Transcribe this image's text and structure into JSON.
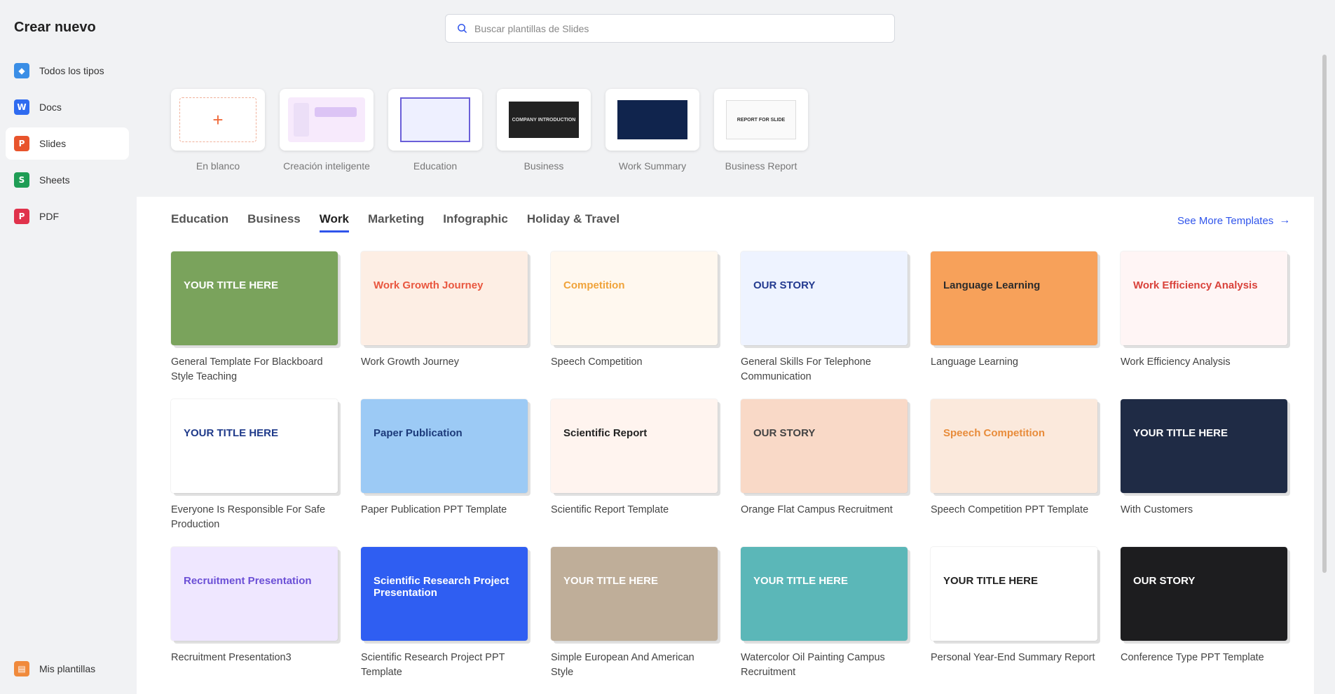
{
  "sidebar": {
    "title": "Crear nuevo",
    "items": [
      {
        "label": "Todos los tipos",
        "icon": "layers-icon",
        "color": "#3a8ee6"
      },
      {
        "label": "Docs",
        "icon": "docs-icon",
        "color": "#2f6bf0",
        "glyph": "W"
      },
      {
        "label": "Slides",
        "icon": "slides-icon",
        "color": "#e8542c",
        "glyph": "P"
      },
      {
        "label": "Sheets",
        "icon": "sheets-icon",
        "color": "#1f9d55",
        "glyph": "S"
      },
      {
        "label": "PDF",
        "icon": "pdf-icon",
        "color": "#e0324b",
        "glyph": "P"
      }
    ],
    "active_index": 2,
    "my_templates": "Mis plantillas"
  },
  "search": {
    "placeholder": "Buscar plantillas de Slides"
  },
  "quick": [
    {
      "label": "En blanco"
    },
    {
      "label": "Creación inteligente"
    },
    {
      "label": "Education"
    },
    {
      "label": "Business",
      "thumb_text": "COMPANY INTRODUCTION"
    },
    {
      "label": "Work Summary"
    },
    {
      "label": "Business Report",
      "thumb_text": "REPORT FOR SLIDE"
    }
  ],
  "tabs": [
    "Education",
    "Business",
    "Work",
    "Marketing",
    "Infographic",
    "Holiday & Travel"
  ],
  "active_tab": 2,
  "see_more": "See More Templates",
  "templates": [
    {
      "title": "General Template For Blackboard Style Teaching",
      "thumb": "YOUR TITLE HERE",
      "bg": "#7aa35c",
      "fg": "#fff"
    },
    {
      "title": "Work Growth Journey",
      "thumb": "Work Growth Journey",
      "bg": "#fdeee4",
      "fg": "#e9573f"
    },
    {
      "title": "Speech Competition",
      "thumb": "Competition",
      "bg": "#fff8ef",
      "fg": "#f0a33a"
    },
    {
      "title": "General Skills For Telephone Communication",
      "thumb": "OUR STORY",
      "bg": "#eef3ff",
      "fg": "#233a8f"
    },
    {
      "title": "Language Learning",
      "thumb": "Language Learning",
      "bg": "#f7a15a",
      "fg": "#2c2c2c"
    },
    {
      "title": "Work Efficiency Analysis",
      "thumb": "Work Efficiency Analysis",
      "bg": "#fff5f5",
      "fg": "#d9423b"
    },
    {
      "title": "Everyone Is Responsible For Safe Production",
      "thumb": "YOUR TITLE HERE",
      "bg": "#ffffff",
      "fg": "#1f3a8a"
    },
    {
      "title": "Paper Publication PPT Template",
      "thumb": "Paper Publication",
      "bg": "#9ccaf5",
      "fg": "#1c3a7a"
    },
    {
      "title": "Scientific Report Template",
      "thumb": "Scientific Report",
      "bg": "#fff4ef",
      "fg": "#222"
    },
    {
      "title": "Orange Flat Campus Recruitment",
      "thumb": "OUR STORY",
      "bg": "#f9d9c7",
      "fg": "#444"
    },
    {
      "title": "Speech Competition PPT Template",
      "thumb": "Speech Competition",
      "bg": "#fbe9dc",
      "fg": "#e88c3b"
    },
    {
      "title": "With Customers",
      "thumb": "YOUR TITLE HERE",
      "bg": "#1f2b45",
      "fg": "#fff"
    },
    {
      "title": "Recruitment Presentation3",
      "thumb": "Recruitment Presentation",
      "bg": "#efe7ff",
      "fg": "#6b4fd6"
    },
    {
      "title": "Scientific Research Project PPT Template",
      "thumb": "Scientific Research Project Presentation",
      "bg": "#2f5ef2",
      "fg": "#fff"
    },
    {
      "title": "Simple European And American Style",
      "thumb": "YOUR TITLE HERE",
      "bg": "#bfae99",
      "fg": "#fff"
    },
    {
      "title": "Watercolor Oil Painting Campus Recruitment",
      "thumb": "YOUR TITLE HERE",
      "bg": "#5bb7b8",
      "fg": "#fff"
    },
    {
      "title": "Personal Year-End Summary Report",
      "thumb": "YOUR TITLE HERE",
      "bg": "#ffffff",
      "fg": "#222"
    },
    {
      "title": "Conference Type PPT Template",
      "thumb": "OUR STORY",
      "bg": "#1d1d1f",
      "fg": "#fff"
    }
  ]
}
